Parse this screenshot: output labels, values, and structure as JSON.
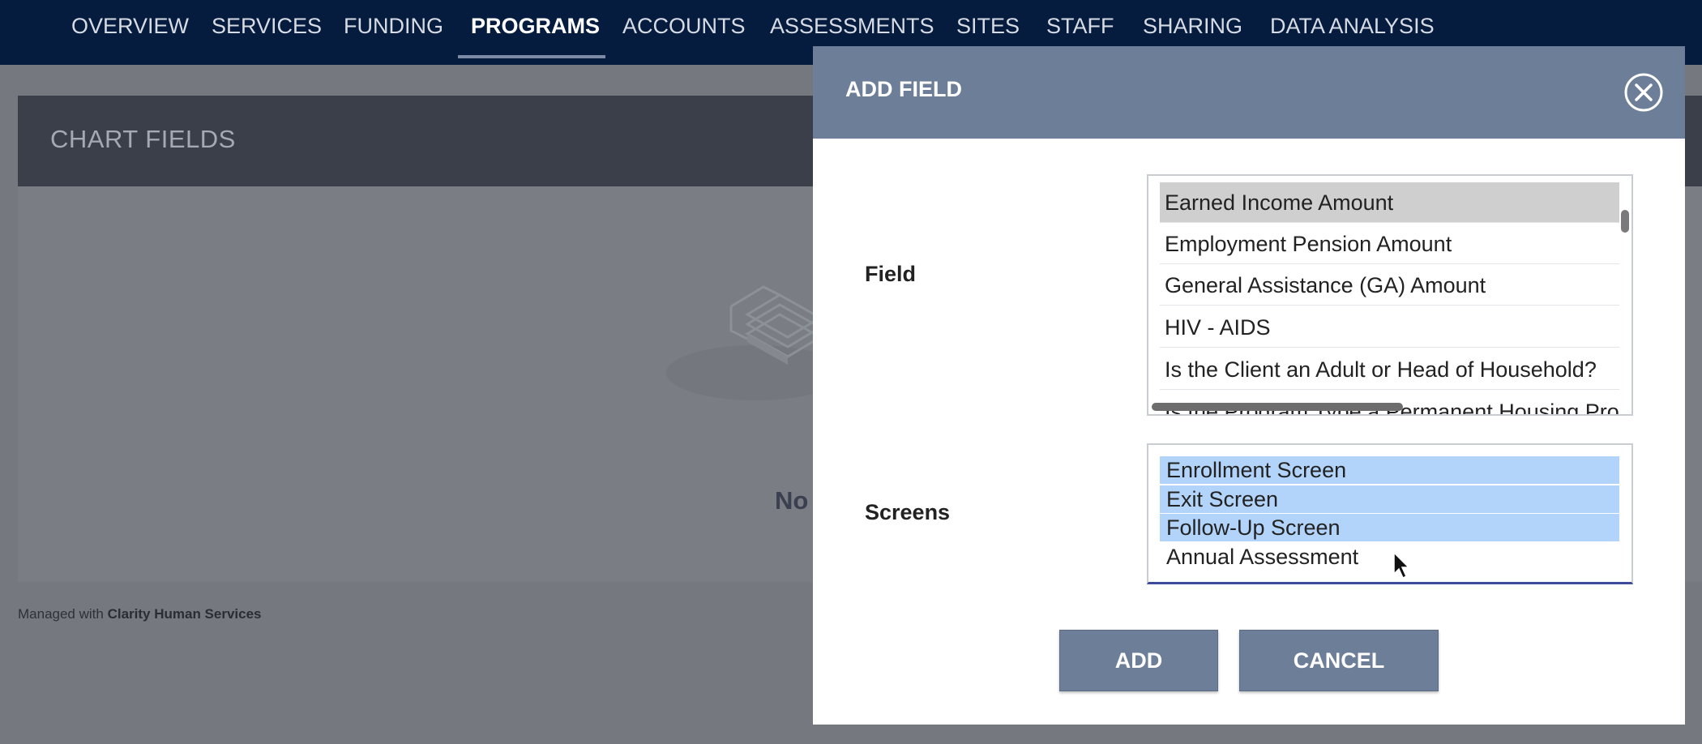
{
  "nav": {
    "items": [
      {
        "label": "OVERVIEW",
        "active": false
      },
      {
        "label": "SERVICES",
        "active": false
      },
      {
        "label": "FUNDING",
        "active": false
      },
      {
        "label": "PROGRAMS",
        "active": true
      },
      {
        "label": "ACCOUNTS",
        "active": false
      },
      {
        "label": "ASSESSMENTS",
        "active": false
      },
      {
        "label": "SITES",
        "active": false
      },
      {
        "label": "STAFF",
        "active": false
      },
      {
        "label": "SHARING",
        "active": false
      },
      {
        "label": "DATA ANALYSIS",
        "active": false
      }
    ]
  },
  "page": {
    "panel_title": "CHART FIELDS",
    "empty_text": "No"
  },
  "footer": {
    "prefix": "Managed with ",
    "brand": "Clarity Human Services"
  },
  "modal": {
    "title": "ADD FIELD",
    "close_icon": "close-circle-icon",
    "field_label": "Field",
    "field_options": [
      {
        "label": "Earned Income Amount",
        "selected": true
      },
      {
        "label": "Employment Pension Amount",
        "selected": false
      },
      {
        "label": "General Assistance (GA) Amount",
        "selected": false
      },
      {
        "label": "HIV - AIDS",
        "selected": false
      },
      {
        "label": "Is the Client an Adult or Head of Household?",
        "selected": false
      },
      {
        "label": "Is the Program Type a Permanent Housing Pro",
        "selected": false
      }
    ],
    "screens_label": "Screens",
    "screen_options": [
      {
        "label": "Enrollment Screen",
        "selected": true
      },
      {
        "label": "Exit Screen",
        "selected": true
      },
      {
        "label": "Follow-Up Screen",
        "selected": true
      },
      {
        "label": "Annual Assessment",
        "selected": false
      }
    ],
    "add_label": "ADD",
    "cancel_label": "CANCEL"
  },
  "colors": {
    "nav_bg": "#051c3f",
    "modal_header": "#6d7e98",
    "selected_screen": "#b2d4fb",
    "selected_field": "#cfcfcf"
  }
}
